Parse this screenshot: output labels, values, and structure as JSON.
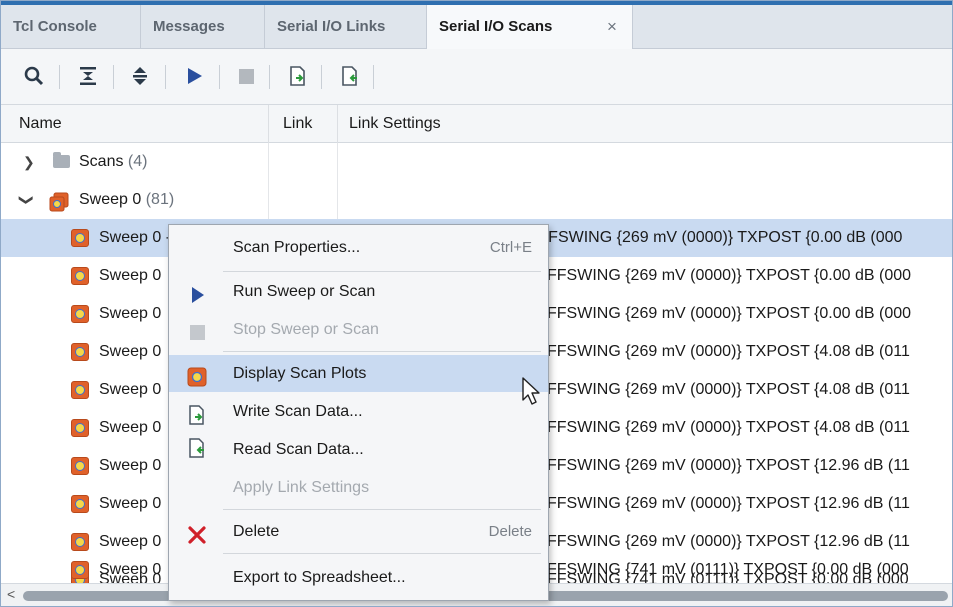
{
  "tabs": [
    {
      "label": "Tcl Console"
    },
    {
      "label": "Messages"
    },
    {
      "label": "Serial I/O Links"
    },
    {
      "label": "Serial I/O Scans",
      "active": true
    }
  ],
  "tab_close": "×",
  "toolbar": {
    "icons": [
      "search-icon",
      "collapse-all-icon",
      "expand-all-icon",
      "run-icon",
      "stop-icon",
      "write-data-icon",
      "read-data-icon"
    ]
  },
  "columns": {
    "name": "Name",
    "link": "Link",
    "link_settings": "Link Settings"
  },
  "tree": {
    "scans": {
      "label": "Scans",
      "count": "(4)"
    },
    "sweep": {
      "label": "Sweep 0",
      "count": "(81)"
    },
    "rows": [
      {
        "name": "Sweep 0 - Scan 0",
        "settings": "EXTERNAL 100 mV) TXDIFFSWING {269 mV (0000)} TXPOST {0.00 dB (000"
      },
      {
        "name": "Sweep 0",
        "settings": "FFSWING {269 mV (0000)} TXPOST {0.00 dB (000"
      },
      {
        "name": "Sweep 0",
        "settings": "FFSWING {269 mV (0000)} TXPOST {0.00 dB (000"
      },
      {
        "name": "Sweep 0",
        "settings": "FFSWING {269 mV (0000)} TXPOST {4.08 dB (011"
      },
      {
        "name": "Sweep 0",
        "settings": "FFSWING {269 mV (0000)} TXPOST {4.08 dB (011"
      },
      {
        "name": "Sweep 0",
        "settings": "FFSWING {269 mV (0000)} TXPOST {4.08 dB (011"
      },
      {
        "name": "Sweep 0",
        "settings": "FFSWING {269 mV (0000)} TXPOST {12.96 dB (11"
      },
      {
        "name": "Sweep 0",
        "settings": "FFSWING {269 mV (0000)} TXPOST {12.96 dB (11"
      },
      {
        "name": "Sweep 0",
        "settings": "FFSWING {269 mV (0000)} TXPOST {12.96 dB (11"
      },
      {
        "name": "Sweep 0",
        "settings": "FFSWING {741 mV (0111)} TXPOST {0.00 dB (000"
      },
      {
        "name": "Sweep 0",
        "settings": "FFSWING {741 mV (0111)} TXPOST {0.00 dB (000"
      }
    ]
  },
  "scroll_left": "<",
  "context_menu": {
    "scan_properties": {
      "label": "Scan Properties...",
      "shortcut": "Ctrl+E"
    },
    "run": {
      "label": "Run Sweep or Scan"
    },
    "stop": {
      "label": "Stop Sweep or Scan"
    },
    "display_plots": {
      "label": "Display Scan Plots"
    },
    "write_data": {
      "label": "Write Scan Data..."
    },
    "read_data": {
      "label": "Read Scan Data..."
    },
    "apply_settings": {
      "label": "Apply Link Settings"
    },
    "delete": {
      "label": "Delete",
      "shortcut": "Delete"
    },
    "export": {
      "label": "Export to Spreadsheet..."
    }
  },
  "colors": {
    "accent": "#2f6fb0",
    "selection": "#c9daf1",
    "delete_red": "#d0202a",
    "run_blue": "#2a4f9e"
  }
}
